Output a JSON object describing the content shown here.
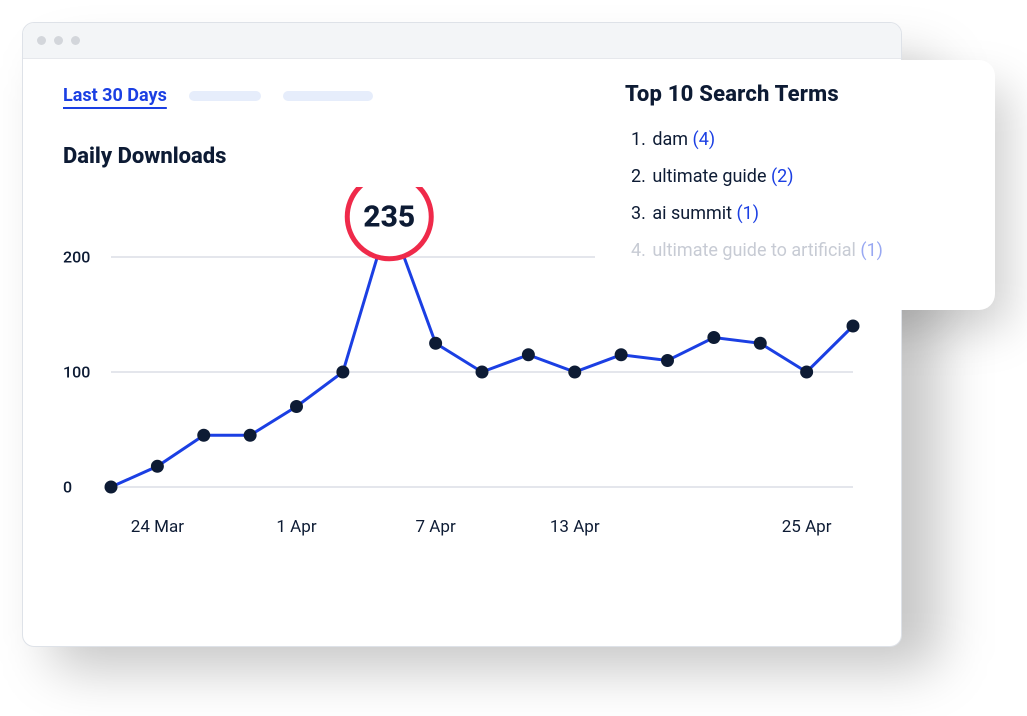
{
  "colors": {
    "accent": "#1b3fe3",
    "text": "#0d1b34",
    "peak": "#ef2a4a"
  },
  "tabs": {
    "active": "Last 30 Days"
  },
  "chart_title": "Daily Downloads",
  "chart_data": {
    "type": "line",
    "title": "Daily Downloads",
    "xlabel": "",
    "ylabel": "",
    "ylim": [
      0,
      200
    ],
    "y_ticks": [
      0,
      100,
      200
    ],
    "x_ticks": [
      "24 Mar",
      "1 Apr",
      "7 Apr",
      "13 Apr",
      "25 Apr"
    ],
    "x": [
      "22 Mar",
      "24 Mar",
      "26 Mar",
      "30 Mar",
      "1 Apr",
      "3 Apr",
      "5 Apr",
      "7 Apr",
      "8 Apr",
      "10 Apr",
      "13 Apr",
      "14 Apr",
      "17 Apr",
      "20 Apr",
      "22 Apr",
      "25 Apr",
      "27 Apr"
    ],
    "values": [
      0,
      18,
      45,
      45,
      70,
      100,
      235,
      125,
      100,
      115,
      100,
      115,
      110,
      130,
      125,
      100,
      140
    ],
    "peak": {
      "index": 6,
      "value": 235
    }
  },
  "search_card": {
    "title": "Top 10 Search  Terms",
    "items": [
      {
        "term": "dam",
        "count": 4
      },
      {
        "term": "ultimate guide",
        "count": 2
      },
      {
        "term": "ai summit",
        "count": 1
      },
      {
        "term": "ultimate guide to artificial",
        "count": 1,
        "faded": true
      }
    ]
  }
}
